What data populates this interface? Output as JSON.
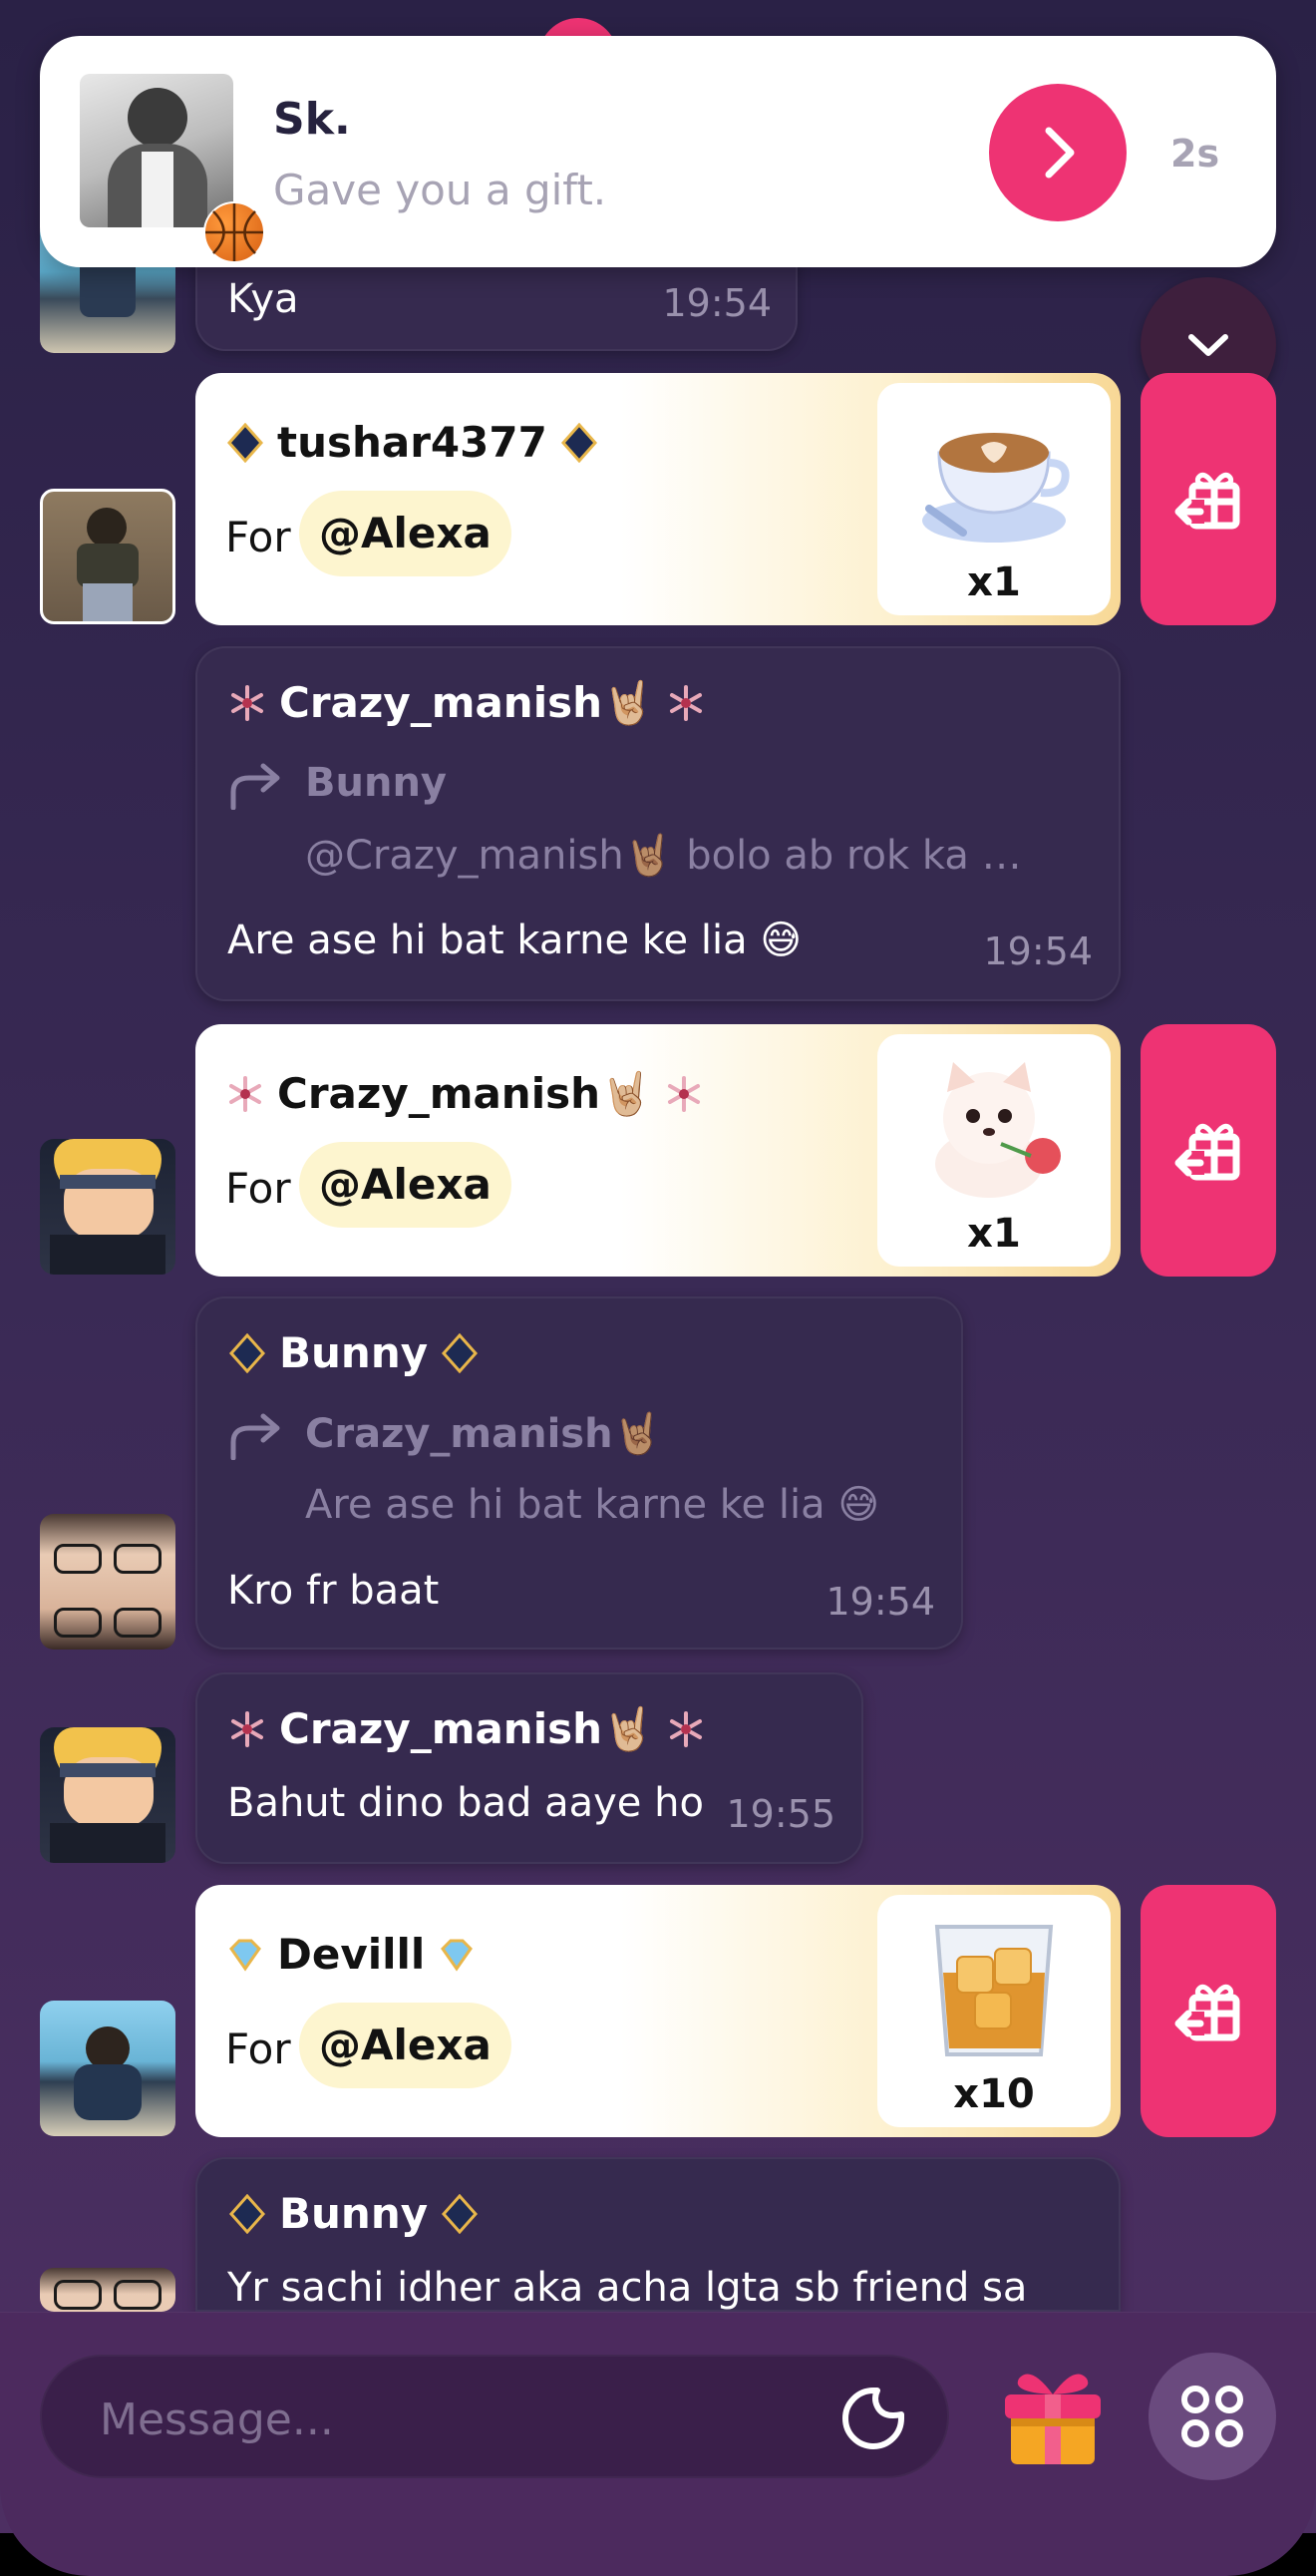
{
  "notification": {
    "sender": "Sk.",
    "text": "Gave you a gift.",
    "time": "2s",
    "sender_badge": "basketball-emoji"
  },
  "messages": {
    "kya": {
      "text": "Kya",
      "time": "19:54"
    },
    "gift1": {
      "user": "tushar4377",
      "for_label": "For",
      "mention": "@Alexa",
      "count": "x1",
      "gift": "coffee-cup"
    },
    "reply1": {
      "user": "Crazy_manish🤘🏼",
      "reply_to": "Bunny",
      "reply_to_text": "@Crazy_manish🤘🏽 bolo ab rok ka …",
      "text": "Are ase hi bat karne ke lia 😅",
      "time": "19:54"
    },
    "gift2": {
      "user": "Crazy_manish🤘🏼",
      "for_label": "For",
      "mention": "@Alexa",
      "count": "x1",
      "gift": "puppy-with-rose"
    },
    "reply2": {
      "user": "Bunny",
      "reply_to": "Crazy_manish🤘🏽",
      "reply_to_text": "Are ase hi bat karne ke lia 😅",
      "text": "Kro fr baat",
      "time": "19:54"
    },
    "msg3": {
      "user": "Crazy_manish🤘🏼",
      "text": "Bahut dino bad aaye ho",
      "time": "19:55"
    },
    "gift3": {
      "user": "Devilll",
      "for_label": "For",
      "mention": "@Alexa",
      "count": "x10",
      "gift": "whiskey-glass"
    },
    "msg4": {
      "user": "Bunny",
      "text": "Yr sachi idher aka acha lgta sb friend sa"
    }
  },
  "composer": {
    "placeholder": "Message..."
  },
  "colors": {
    "accent": "#ee3373",
    "background": "#2a2146",
    "bubble": "#362a4f"
  }
}
